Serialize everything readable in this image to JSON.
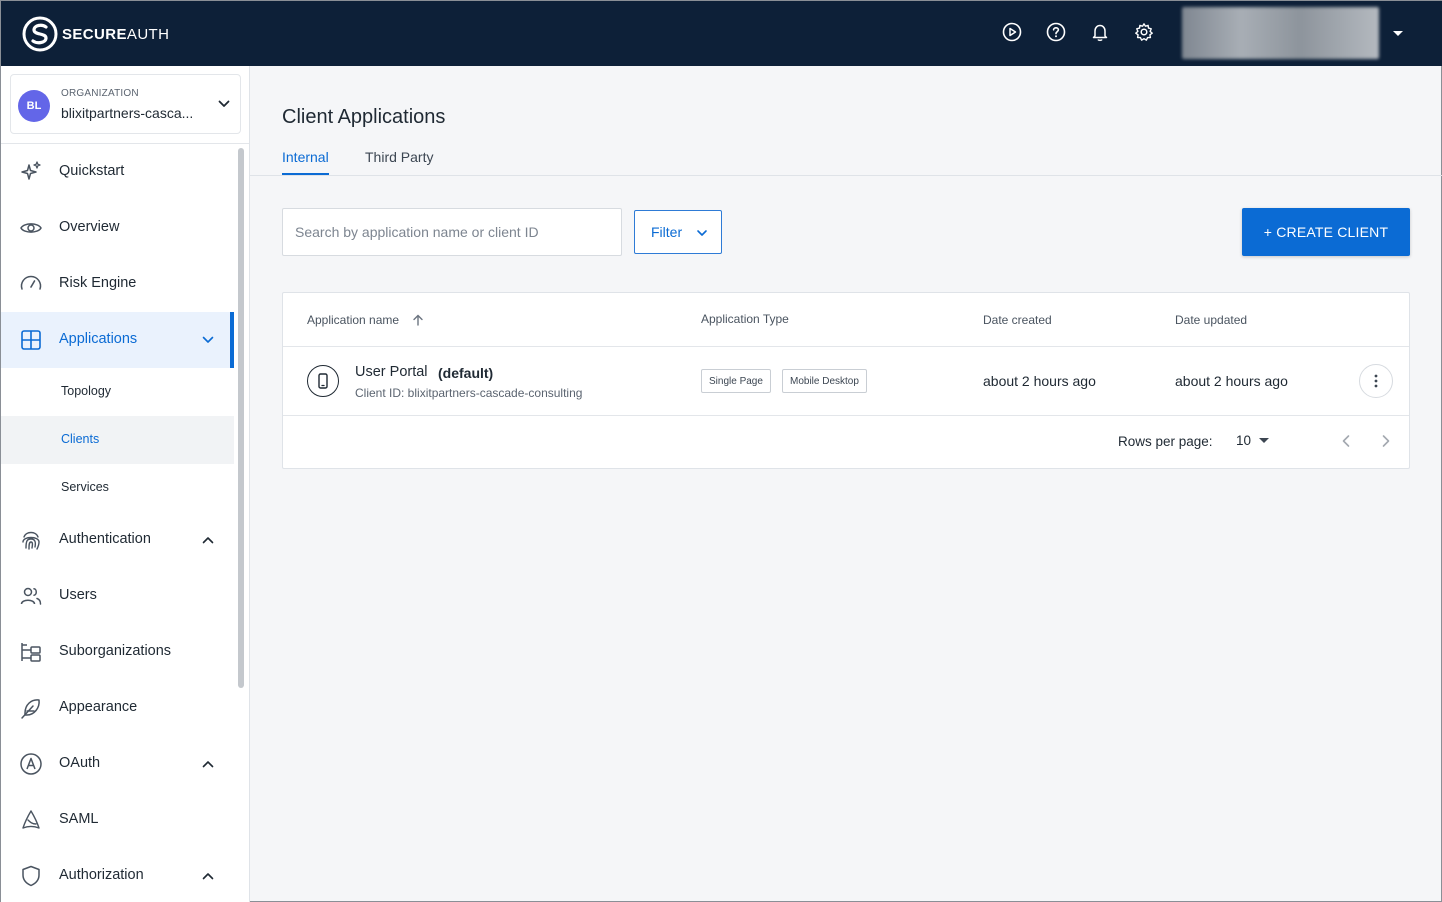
{
  "brand": {
    "name_bold": "SECURE",
    "name_thin": "AUTH"
  },
  "topbar": {
    "icons": [
      "play-circle-icon",
      "help-icon",
      "bell-icon",
      "gear-icon"
    ]
  },
  "org": {
    "avatar": "BL",
    "label": "ORGANIZATION",
    "name": "blixitpartners-casca..."
  },
  "nav": {
    "quickstart": "Quickstart",
    "overview": "Overview",
    "risk_engine": "Risk Engine",
    "applications": "Applications",
    "topology": "Topology",
    "clients": "Clients",
    "services": "Services",
    "authentication": "Authentication",
    "users": "Users",
    "suborganizations": "Suborganizations",
    "appearance": "Appearance",
    "oauth": "OAuth",
    "saml": "SAML",
    "authorization": "Authorization"
  },
  "colors": {
    "accent": "#0b6bd4",
    "topbar": "#0d2038",
    "avatar": "#6366e8"
  },
  "main": {
    "title": "Client Applications",
    "tabs": [
      {
        "label": "Internal",
        "active": true
      },
      {
        "label": "Third Party",
        "active": false
      }
    ],
    "search_placeholder": "Search by application name or client ID",
    "filter_label": "Filter",
    "create_label": "+ CREATE CLIENT",
    "table": {
      "headers": [
        "Application name",
        "Application Type",
        "Date created",
        "Date updated"
      ],
      "rows": [
        {
          "name": "User Portal",
          "tag": "(default)",
          "client_id": "Client ID: blixitpartners-cascade-consulting",
          "types": [
            "Single Page",
            "Mobile Desktop"
          ],
          "created": "about 2 hours ago",
          "updated": "about 2 hours ago"
        }
      ]
    },
    "pagination": {
      "rows_per_page_label": "Rows per page:",
      "rows_per_page": "10"
    }
  }
}
